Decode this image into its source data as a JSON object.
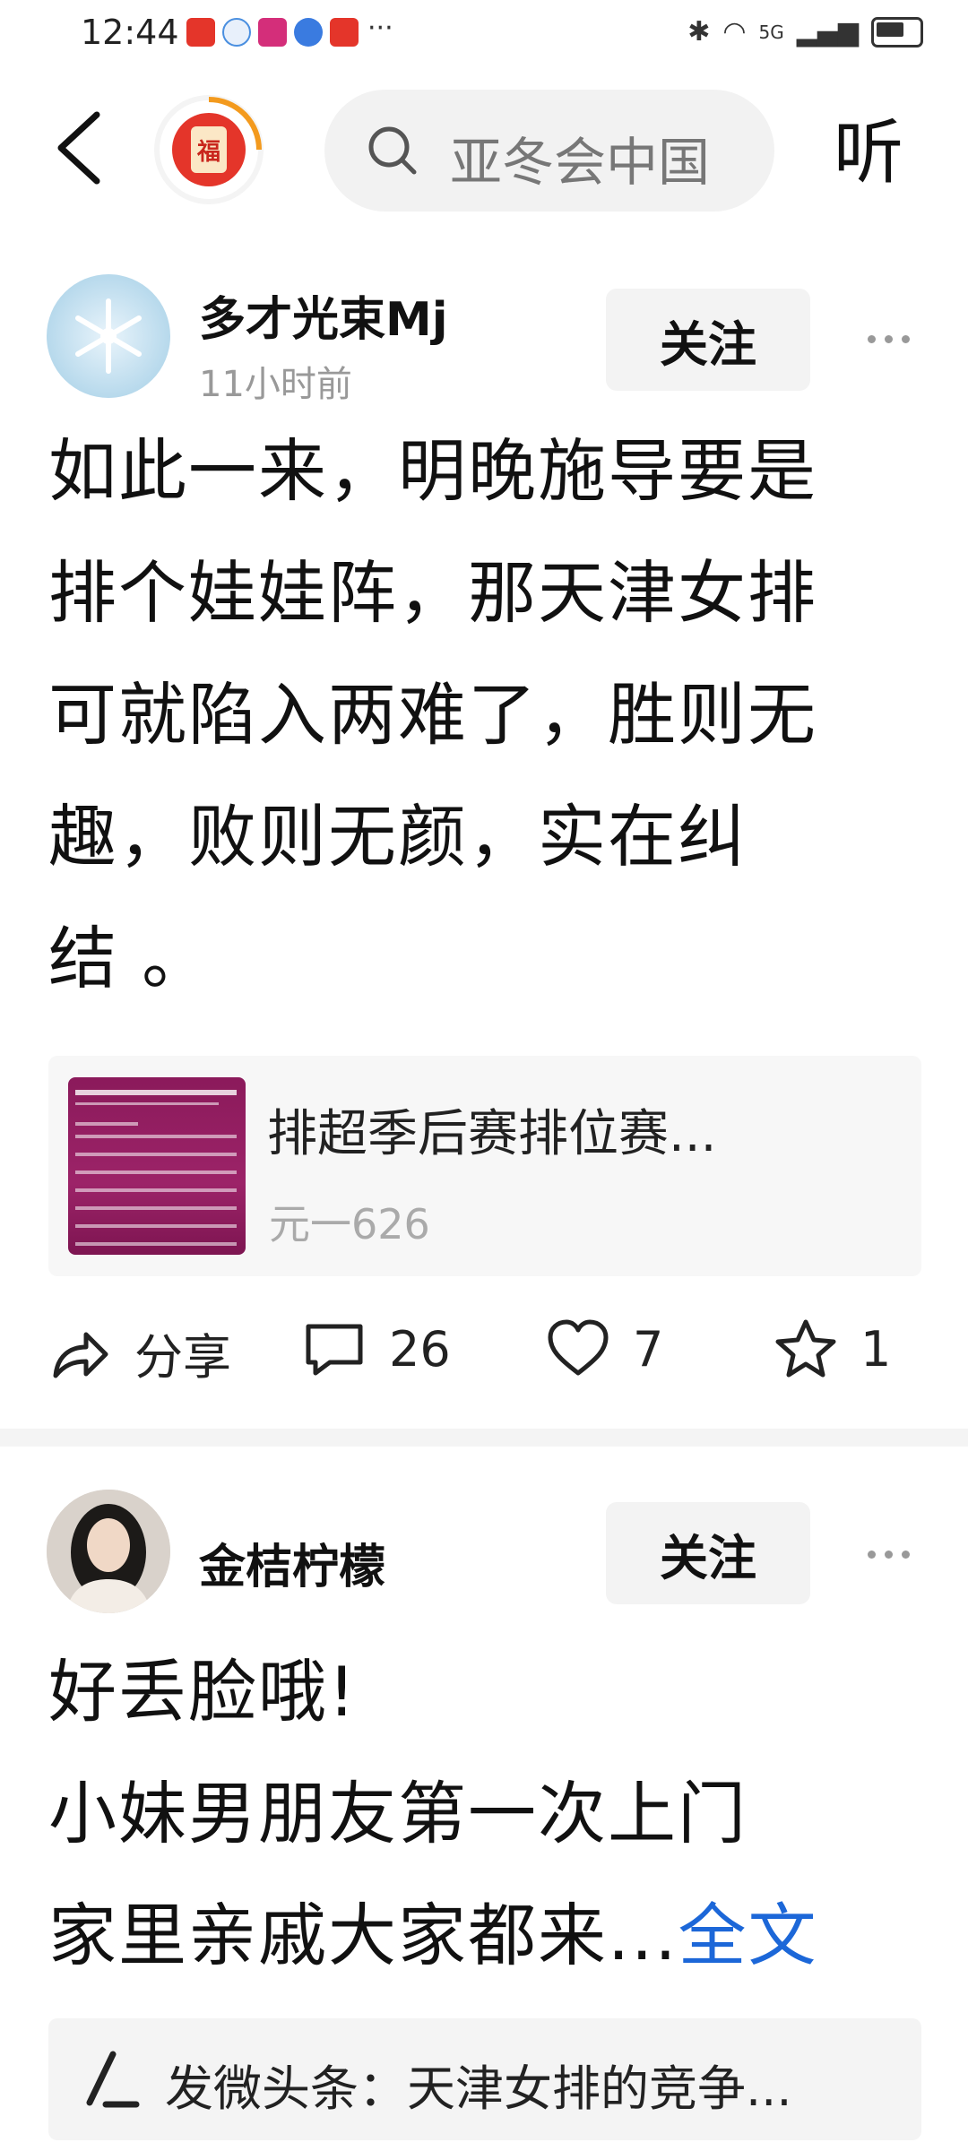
{
  "status_bar": {
    "time": "12:44",
    "network": "5G",
    "more": "···"
  },
  "top_bar": {
    "avatar_char": "福",
    "search_placeholder": "亚冬会中国",
    "listen_label": "听"
  },
  "posts": [
    {
      "username": "多才光束Mj",
      "time": "11小时前",
      "follow_label": "关注",
      "text": [
        "如此一来，明晚施导要是",
        "排个娃娃阵，那天津女排",
        "可就陷入两难了，胜则无",
        "趣，败则无颜，实在纠",
        "结 。"
      ],
      "link_card": {
        "title": "排超季后赛排位赛...",
        "subtitle": "元一626"
      },
      "actions": {
        "share_label": "分享",
        "comments": "26",
        "likes": "7",
        "favorites": "1"
      }
    },
    {
      "username": "金桔柠檬",
      "follow_label": "关注",
      "text": [
        "好丢脸哦!",
        "小妹男朋友第一次上门",
        "家里亲戚大家都来..."
      ],
      "full_text_label": "全文",
      "quote": "发微头条：天津女排的竞争..."
    }
  ],
  "colors": {
    "link_blue": "#1c67d8",
    "accent_red": "#e4352a",
    "thumb_purple": "#8b1a5b"
  }
}
